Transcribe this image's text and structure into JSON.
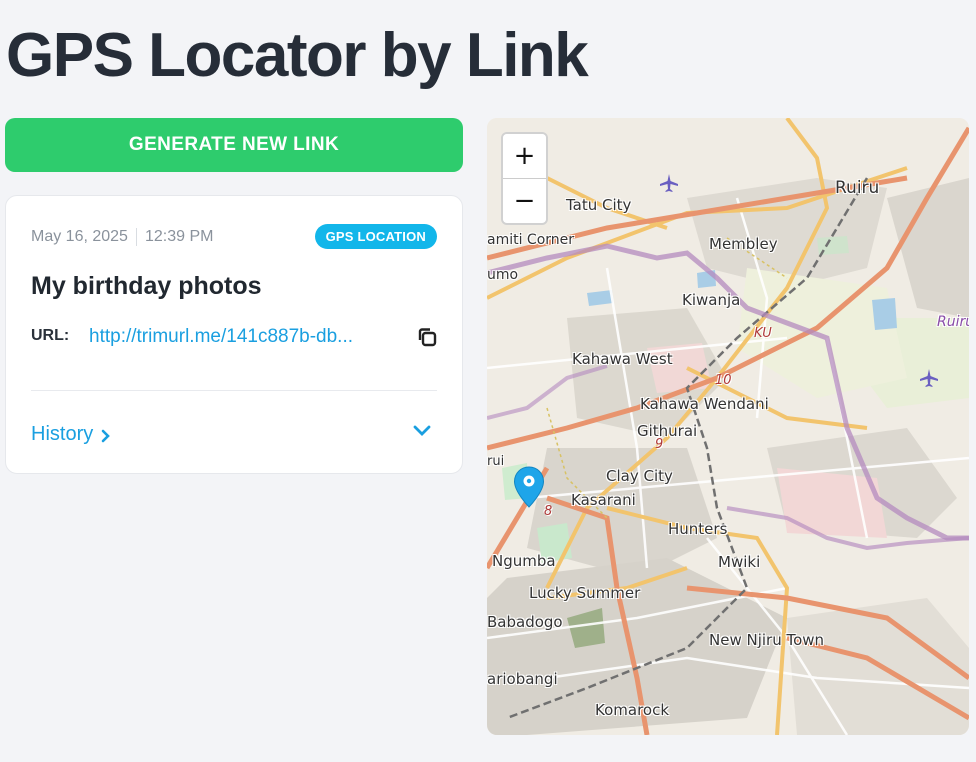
{
  "page": {
    "title": "GPS Locator by Link"
  },
  "actions": {
    "generate_label": "GENERATE NEW LINK"
  },
  "card": {
    "date": "May 16, 2025",
    "time": "12:39 PM",
    "badge": "GPS LOCATION",
    "title": "My birthday photos",
    "url_label": "URL:",
    "url": "http://trimurl.me/141c887b-db...",
    "history_label": "History"
  },
  "map": {
    "zoom_in": "+",
    "zoom_out": "−",
    "places": [
      {
        "name": "Tatu City"
      },
      {
        "name": "Ruiru"
      },
      {
        "name": "Membley"
      },
      {
        "name": "amiti Corner"
      },
      {
        "name": "umo"
      },
      {
        "name": "Kiwanja"
      },
      {
        "name": "Kahawa West"
      },
      {
        "name": "Kahawa Wendani"
      },
      {
        "name": "Githurai"
      },
      {
        "name": "Clay City"
      },
      {
        "name": "Kasarani"
      },
      {
        "name": "Hunters"
      },
      {
        "name": "Mwiki"
      },
      {
        "name": "Ngumba"
      },
      {
        "name": "Lucky Summer"
      },
      {
        "name": "Babadogo"
      },
      {
        "name": "New Njiru Town"
      },
      {
        "name": "ariobangi"
      },
      {
        "name": "Komarock"
      },
      {
        "name": "rui"
      },
      {
        "name": "Ruiru"
      },
      {
        "name": "KU"
      }
    ],
    "road_numbers": [
      "10",
      "9",
      "8"
    ],
    "marker": "location-pin",
    "colors": {
      "pin": "#1ea5e9",
      "trunk": "#e9906f",
      "primary": "#f4bf6c",
      "boundary": "#a46ab0"
    }
  },
  "icons": {
    "copy": "copy-icon",
    "history_chevron": "chevron-right-icon",
    "expand": "chevron-down-icon",
    "airport": "airplane-icon"
  }
}
